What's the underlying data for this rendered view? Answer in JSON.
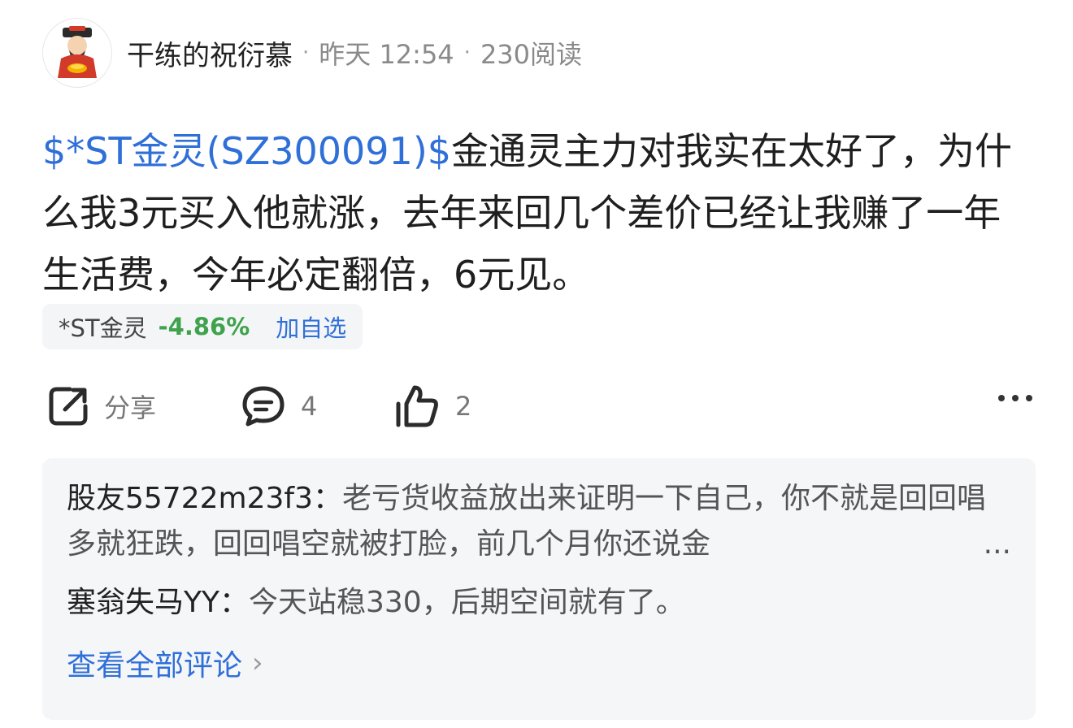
{
  "author": {
    "name": "干练的祝衍慕",
    "time": "昨天 12:54",
    "reads": "230阅读",
    "separator": "·"
  },
  "post": {
    "stock_tag": "$*ST金灵(SZ300091)$",
    "text": "金通灵主力对我实在太好了，为什么我3元买入他就涨，去年来回几个差价已经让我赚了一年生活费，今年必定翻倍，6元见。"
  },
  "stock_chip": {
    "name": "*ST金灵",
    "change": "-4.86%",
    "change_color": "#3fa34d",
    "add_label": "加自选"
  },
  "actions": {
    "share": {
      "icon": "share-icon",
      "label": "分享"
    },
    "comment": {
      "icon": "comment-icon",
      "count": "4"
    },
    "like": {
      "icon": "thumbs-up-icon",
      "count": "2"
    },
    "more": {
      "icon": "more-icon"
    }
  },
  "comments": [
    {
      "user": "股友55722m23f3：",
      "text": "老亏货收益放出来证明一下自己，你不就是回回唱多就狂跌，回回唱空就被打脸，前几个月你还说金",
      "truncated": "..."
    },
    {
      "user": "塞翁失马YY：",
      "text": "今天站稳330，后期空间就有了。"
    }
  ],
  "view_all": {
    "label": "查看全部评论",
    "chevron": "›"
  },
  "colors": {
    "link": "#2f6fd8",
    "down": "#3fa34d",
    "panel": "#f5f6f8"
  }
}
